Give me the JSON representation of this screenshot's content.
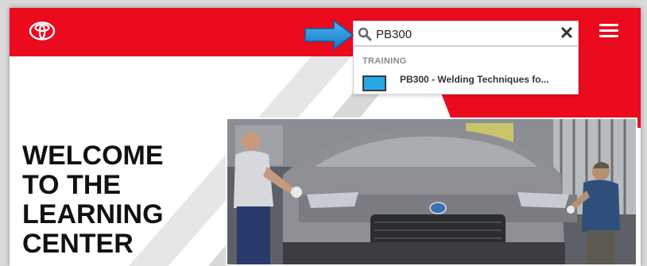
{
  "header": {
    "brand_color": "#eb0a1e",
    "logo_icon": "toyota-logo-icon",
    "menu_icon": "hamburger-menu-icon"
  },
  "search": {
    "value": "PB300",
    "icon": "search-icon",
    "clear_icon": "close-icon",
    "clear_glyph": "✕"
  },
  "dropdown": {
    "group_label": "TRAINING",
    "results": [
      {
        "label": "PB300 - Welding Techniques fo...",
        "thumb_color": "#27a6e6"
      }
    ]
  },
  "hero": {
    "headline_lines": [
      "WELCOME",
      "TO THE",
      "LEARNING",
      "CENTER"
    ]
  },
  "annotation": {
    "arrow_color": "#1f8fd6",
    "arrow_icon": "pointer-arrow-icon"
  }
}
